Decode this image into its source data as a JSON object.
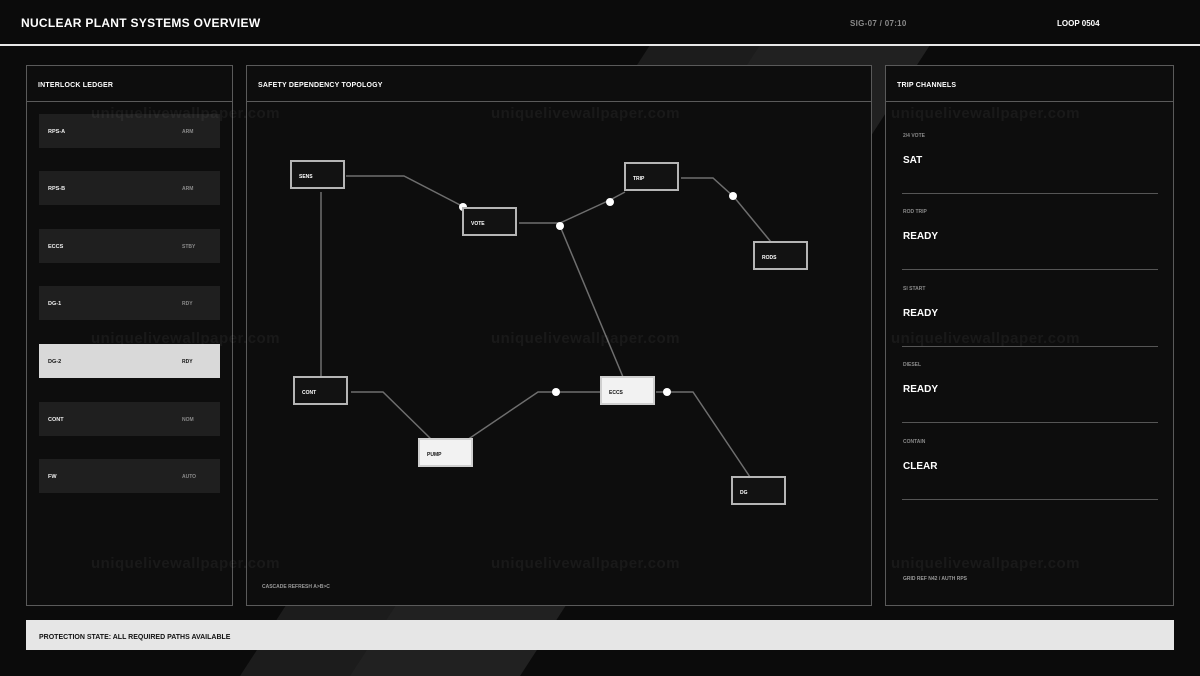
{
  "header": {
    "title": "NUCLEAR PLANT SYSTEMS OVERVIEW",
    "signal": "SIG-07  /  07:10",
    "loop": "LOOP 0504"
  },
  "ledger": {
    "title": "INTERLOCK LEDGER",
    "rows": [
      {
        "name": "RPS-A",
        "state": "ARM"
      },
      {
        "name": "RPS-B",
        "state": "ARM"
      },
      {
        "name": "ECCS",
        "state": "STBY"
      },
      {
        "name": "DG-1",
        "state": "RDY"
      },
      {
        "name": "DG-2",
        "state": "RDY"
      },
      {
        "name": "CONT",
        "state": "NOM"
      },
      {
        "name": "FW",
        "state": "AUTO"
      }
    ]
  },
  "topology": {
    "title": "SAFETY DEPENDENCY TOPOLOGY",
    "footnote": "CASCADE REFRESH  A>B>C",
    "nodes": {
      "sens": "SENS",
      "vote": "VOTE",
      "trip": "TRIP",
      "rods": "RODS",
      "cont": "CONT",
      "pump": "PUMP",
      "eccs": "ECCS",
      "dg": "DG"
    }
  },
  "channels": {
    "title": "TRIP CHANNELS",
    "items": [
      {
        "label": "2/4 VOTE",
        "value": "SAT"
      },
      {
        "label": "ROD TRIP",
        "value": "READY"
      },
      {
        "label": "SI START",
        "value": "READY"
      },
      {
        "label": "DIESEL",
        "value": "READY"
      },
      {
        "label": "CONTAIN",
        "value": "CLEAR"
      }
    ],
    "footnote": "GRID REF N42 / AUTH RPS"
  },
  "status": {
    "text": "PROTECTION STATE: ALL REQUIRED PATHS AVAILABLE"
  },
  "watermark": "uniquelivewallpaper.com",
  "colors": {
    "background": "#0b0b0b",
    "panel_border": "#5a5a5a",
    "highlight": "#d9d9d9",
    "status_bar": "#e6e6e6"
  }
}
